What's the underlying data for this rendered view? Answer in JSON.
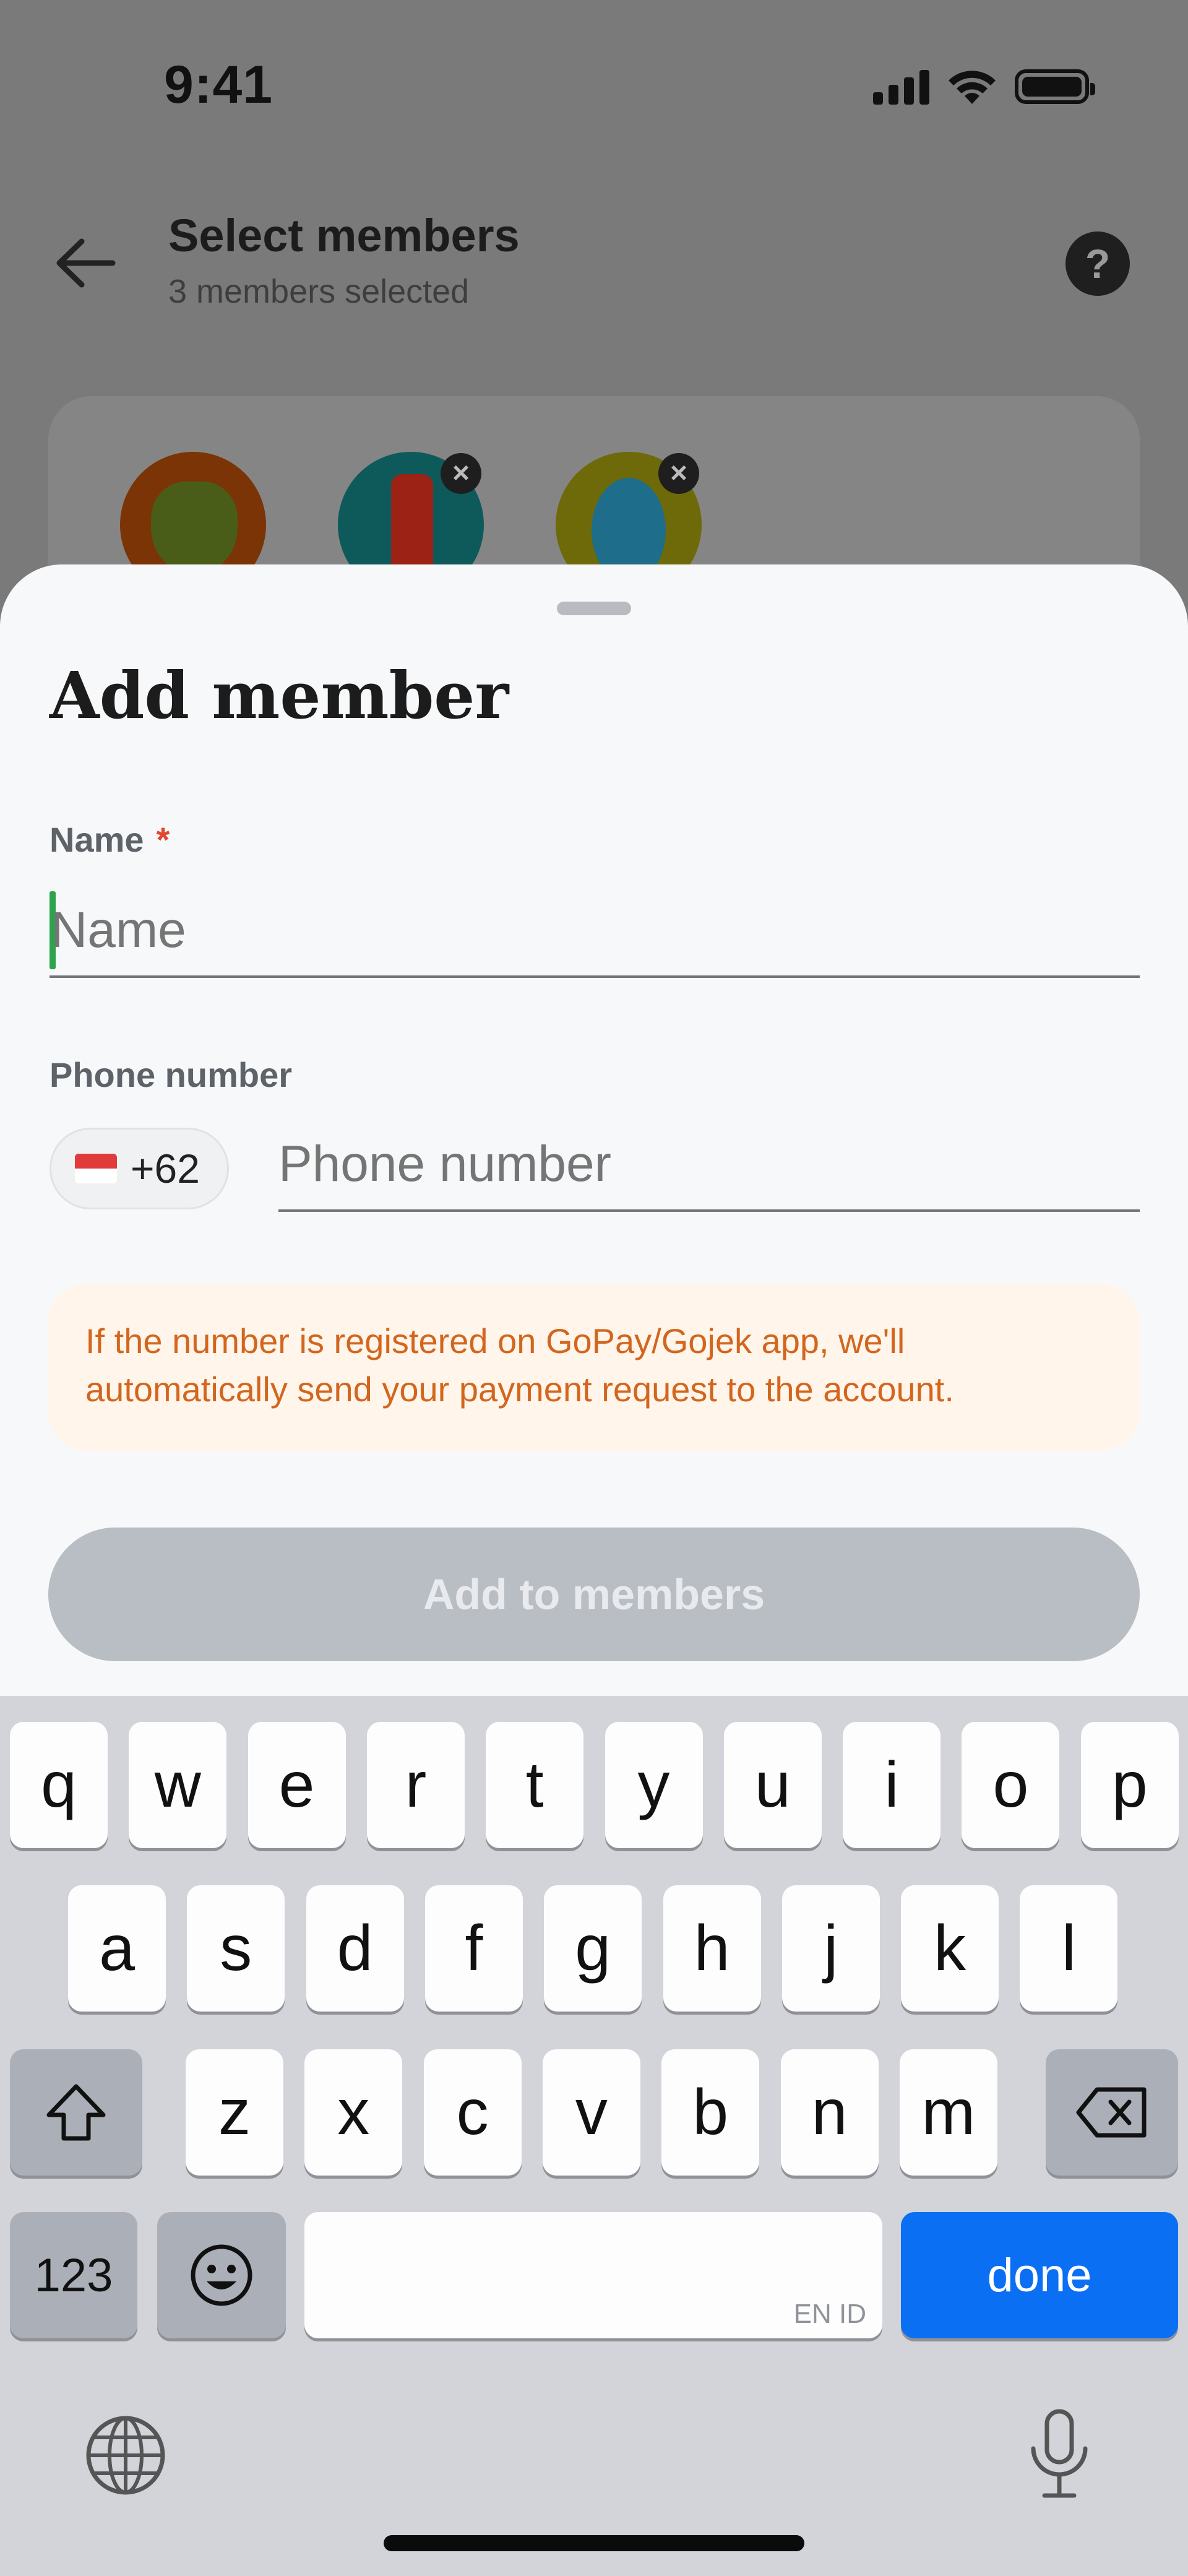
{
  "status_bar": {
    "time": "9:41"
  },
  "header": {
    "title": "Select members",
    "subtitle": "3 members selected",
    "help_label": "?"
  },
  "selected_members": {
    "count": 3,
    "remove_label": "×"
  },
  "sheet": {
    "title": "Add member",
    "name_label": "Name",
    "required_marker": "*",
    "name_placeholder": "Name",
    "name_value": "",
    "phone_label": "Phone number",
    "country_code": "+62",
    "phone_placeholder": "Phone number",
    "phone_value": "",
    "note": "If the number is registered on GoPay/Gojek app, we'll automatically send your payment request to the account.",
    "add_button": "Add to members"
  },
  "keyboard": {
    "row1": [
      "q",
      "w",
      "e",
      "r",
      "t",
      "y",
      "u",
      "i",
      "o",
      "p"
    ],
    "row2": [
      "a",
      "s",
      "d",
      "f",
      "g",
      "h",
      "j",
      "k",
      "l"
    ],
    "row3": [
      "z",
      "x",
      "c",
      "v",
      "b",
      "n",
      "m"
    ],
    "numbers_key": "123",
    "language_tag": "EN ID",
    "done_key": "done"
  },
  "colors": {
    "accent_blue": "#0b6ff4",
    "caret_green": "#2ea34e",
    "note_text": "#d3661e",
    "note_bg": "#fff5ea",
    "required": "#e2462f"
  }
}
